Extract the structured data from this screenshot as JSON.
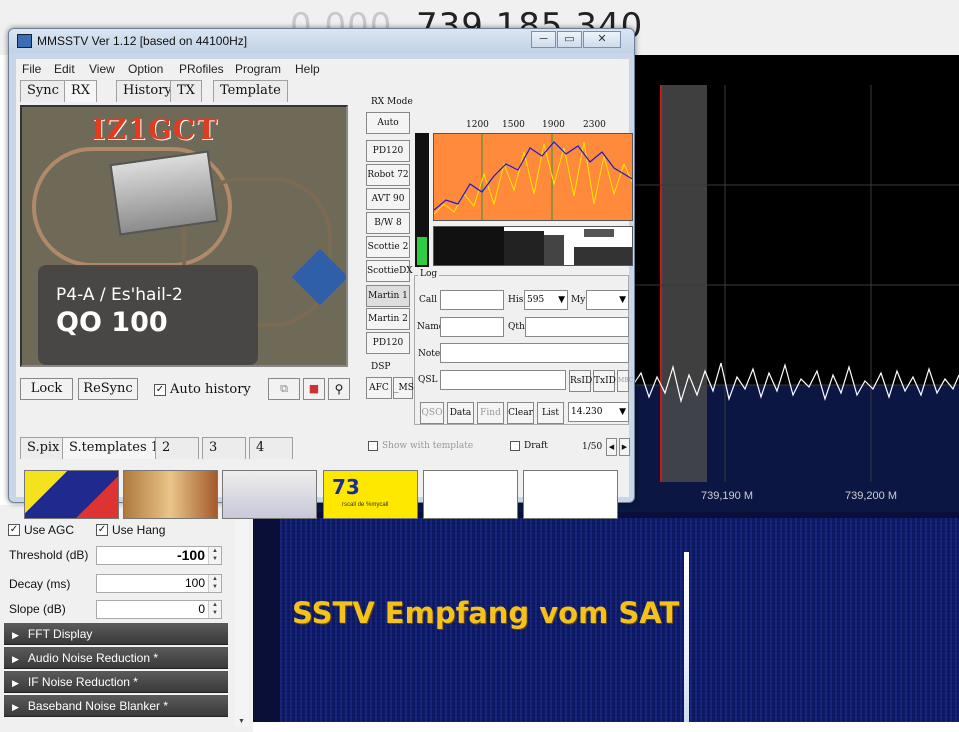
{
  "sdr": {
    "frequency_dim": "0.000.",
    "frequency_main": "739.185.340",
    "axis_labels": [
      "739,190 M",
      "739,200 M"
    ],
    "overlay_text": "SSTV Empfang vom SAT"
  },
  "left_panel": {
    "use_agc": "Use AGC",
    "use_hang": "Use Hang",
    "threshold_label": "Threshold (dB)",
    "threshold_value": "-100",
    "decay_label": "Decay (ms)",
    "decay_value": "100",
    "slope_label": "Slope (dB)",
    "slope_value": "0",
    "sections": [
      "FFT Display",
      "Audio Noise Reduction *",
      "IF Noise Reduction *",
      "Baseband Noise Blanker *"
    ]
  },
  "mmsstv": {
    "title": "MMSSTV Ver 1.12 [based on 44100Hz]",
    "menu": [
      "File",
      "Edit",
      "View",
      "Option",
      "PRofiles",
      "Program",
      "Help"
    ],
    "tabs": [
      "Sync",
      "RX",
      "History",
      "TX",
      "Template"
    ],
    "image": {
      "callsign": "IZ1GCT",
      "line1": "P4-A / Es'hail-2",
      "line2": "QO 100"
    },
    "rx_mode_label": "RX Mode",
    "modes": [
      "Auto",
      "PD120",
      "Robot 72",
      "AVT 90",
      "B/W 8",
      "Scottie 2",
      "ScottieDX",
      "Martin 1",
      "Martin 2",
      "PD120"
    ],
    "dsp_label": "DSP",
    "afc": "AFC",
    "ms": "_MS",
    "spectrum_ticks": [
      "1200",
      "1500",
      "1900",
      "2300"
    ],
    "bottom_buttons": {
      "lock": "Lock",
      "resync": "ReSync",
      "auto_history": "Auto history"
    },
    "log": {
      "label": "Log",
      "call": "Call",
      "his": "His",
      "his_value": "595",
      "my": "My",
      "name": "Name",
      "qth": "Qth",
      "note": "Note",
      "qsl": "QSL",
      "rsid": "RsID",
      "txid": "TxID",
      "mbc": "MBC",
      "qso": "QSO",
      "data": "Data",
      "find": "Find",
      "clear": "Clear",
      "list": "List",
      "freq": "14.230"
    },
    "show_with_template": "Show with template",
    "draft": "Draft",
    "page_counter": "1/50",
    "bottom_tabs": [
      "S.pix",
      "S.templates 1",
      "2",
      "3",
      "4"
    ],
    "thumbnails": [
      "73"
    ],
    "thumb_caption": "rscall de %mycall"
  },
  "colors": {
    "spectrum_orange": "#ff8a3c",
    "overlay_yellow": "#f5c21c",
    "waterfall_blue": "#0b1760"
  }
}
